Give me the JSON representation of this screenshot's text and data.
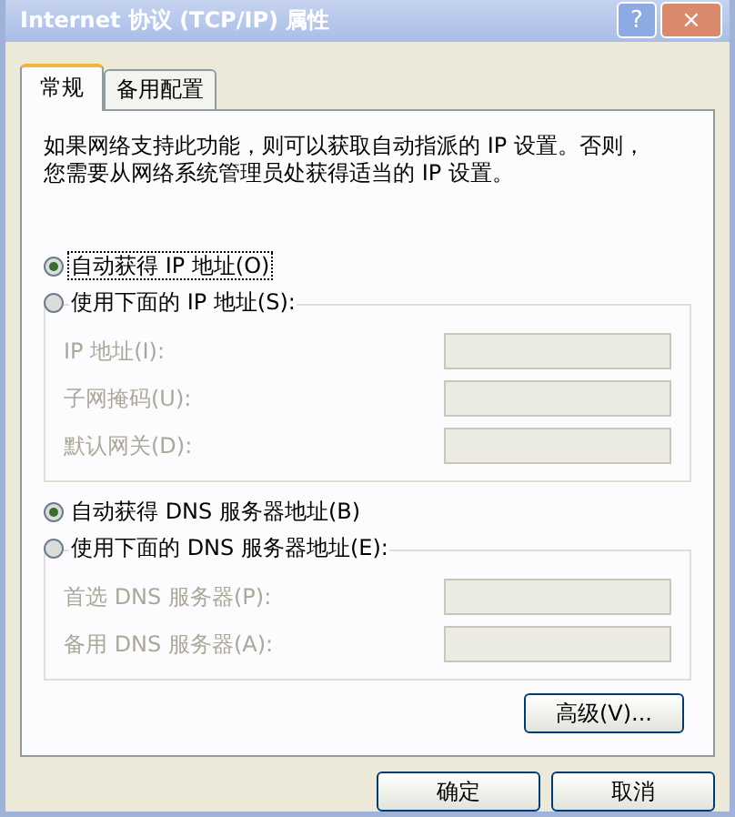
{
  "window": {
    "title": "Internet 协议 (TCP/IP) 属性",
    "title_buttons": [
      {
        "kind": "help",
        "label": "?"
      },
      {
        "kind": "close",
        "label": "×"
      }
    ]
  },
  "tabs": [
    {
      "label": "常规",
      "selected": true
    },
    {
      "label": "备用配置",
      "selected": false
    }
  ],
  "description_lines": [
    "如果网络支持此功能，则可以获取自动指派的 IP 设置。否则，",
    "您需要从网络系统管理员处获得适当的 IP 设置。"
  ],
  "ip_options": [
    {
      "label": "自动获得 IP 地址(O)",
      "selected": true
    },
    {
      "label": "使用下面的 IP 地址(S):",
      "selected": false
    }
  ],
  "ip_fields": [
    {
      "label": "IP 地址(I):",
      "disabled": true
    },
    {
      "label": "子网掩码(U):",
      "disabled": true
    },
    {
      "label": "默认网关(D):",
      "disabled": true
    }
  ],
  "dns_options": [
    {
      "label": "自动获得 DNS 服务器地址(B)",
      "selected": true
    },
    {
      "label": "使用下面的 DNS 服务器地址(E):",
      "selected": false
    }
  ],
  "dns_fields": [
    {
      "label": "首选 DNS 服务器(P):",
      "disabled": true
    },
    {
      "label": "备用 DNS 服务器(A):",
      "disabled": true
    }
  ],
  "advanced_button": "高级(V)...",
  "buttons": [
    "确定",
    "取消"
  ]
}
